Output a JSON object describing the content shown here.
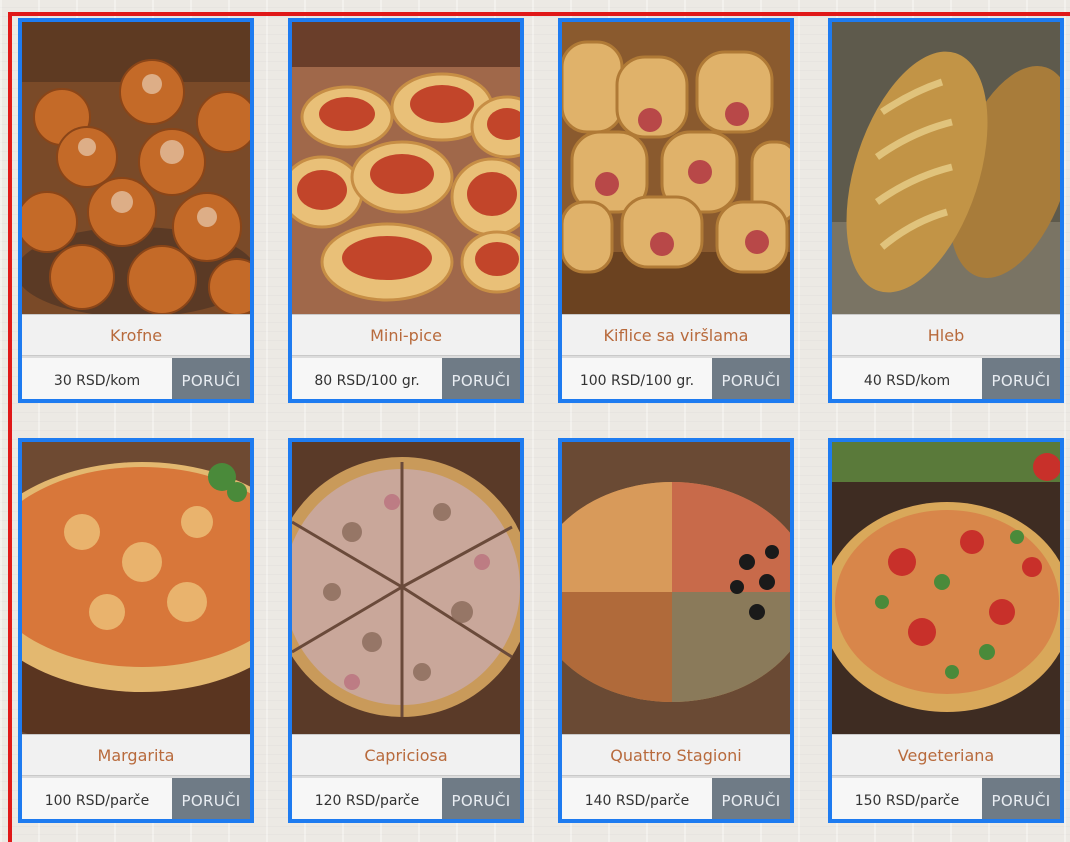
{
  "order_label": "PORUČI",
  "products": [
    {
      "name": "Krofne",
      "price": "30 RSD/kom",
      "image": "donuts"
    },
    {
      "name": "Mini-pice",
      "price": "80 RSD/100 gr.",
      "image": "mini-pizzas"
    },
    {
      "name": "Kiflice sa viršlama",
      "price": "100 RSD/100 gr.",
      "image": "sausage-rolls"
    },
    {
      "name": "Hleb",
      "price": "40 RSD/kom",
      "image": "bread"
    },
    {
      "name": "Margarita",
      "price": "100 RSD/parče",
      "image": "pizza-margarita"
    },
    {
      "name": "Capriciosa",
      "price": "120 RSD/parče",
      "image": "pizza-capriciosa"
    },
    {
      "name": "Quattro Stagioni",
      "price": "140 RSD/parče",
      "image": "pizza-quattro-stagioni"
    },
    {
      "name": "Vegeteriana",
      "price": "150 RSD/parče",
      "image": "pizza-vegeteriana"
    }
  ],
  "colors": {
    "frame_red": "#e01818",
    "card_border_blue": "#1e7bf0",
    "name_text": "#b86a3c",
    "order_button_bg": "#6f7b86"
  }
}
